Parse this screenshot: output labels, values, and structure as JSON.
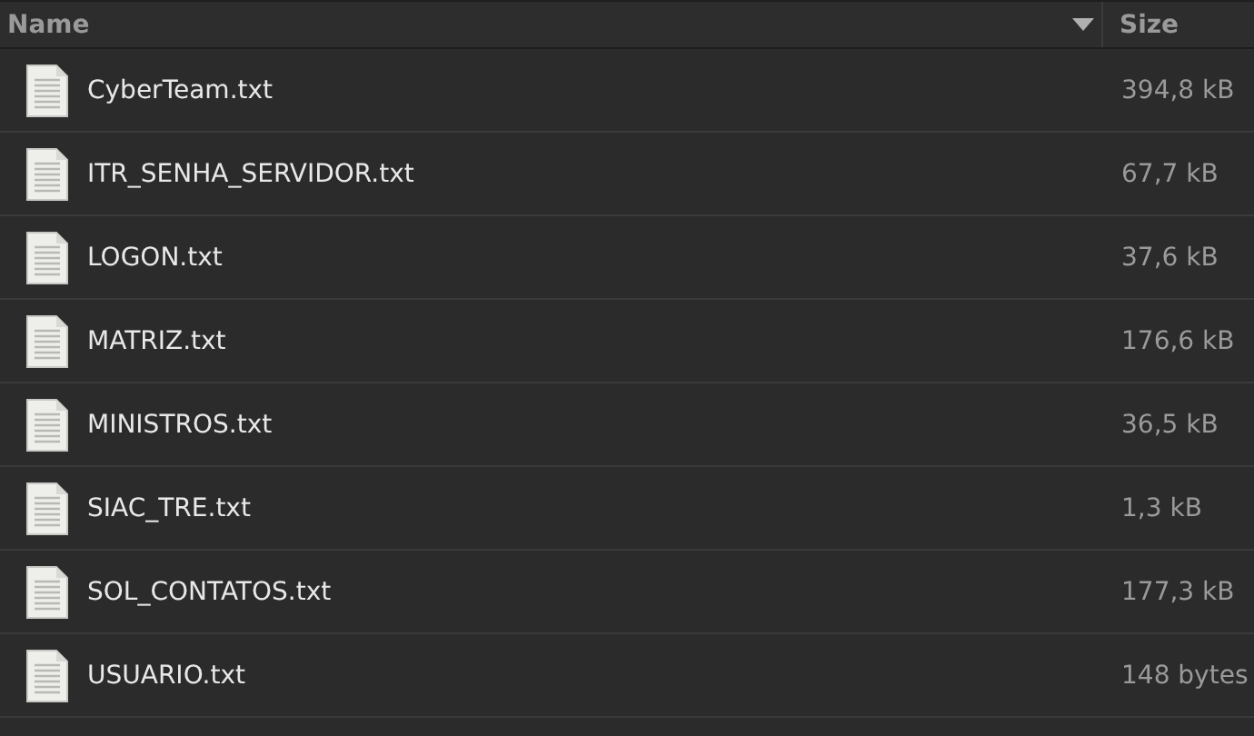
{
  "table": {
    "columns": [
      {
        "label": "Name"
      },
      {
        "label": "Size"
      }
    ],
    "rows": [
      {
        "name": "CyberTeam.txt",
        "size": "394,8 kB"
      },
      {
        "name": "ITR_SENHA_SERVIDOR.txt",
        "size": "67,7 kB"
      },
      {
        "name": "LOGON.txt",
        "size": "37,6 kB"
      },
      {
        "name": "MATRIZ.txt",
        "size": "176,6 kB"
      },
      {
        "name": "MINISTROS.txt",
        "size": "36,5 kB"
      },
      {
        "name": "SIAC_TRE.txt",
        "size": "1,3 kB"
      },
      {
        "name": "SOL_CONTATOS.txt",
        "size": "177,3 kB"
      },
      {
        "name": "USUARIO.txt",
        "size": "148 bytes"
      }
    ]
  }
}
